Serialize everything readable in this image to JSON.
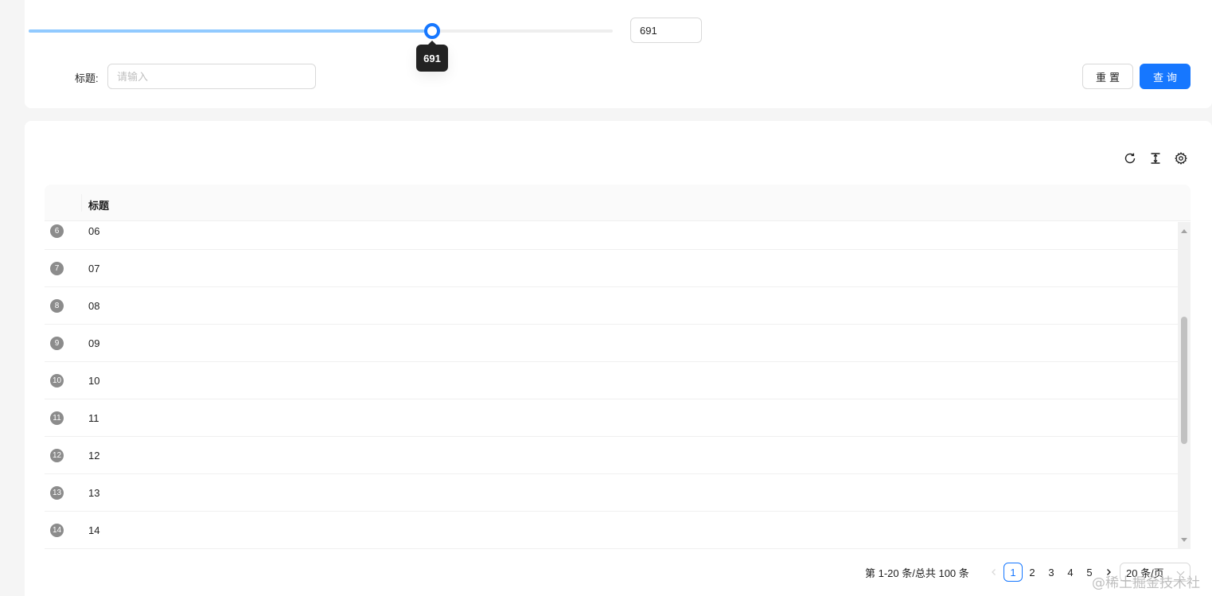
{
  "search": {
    "slider_value": 691,
    "slider_min": 0,
    "slider_max": 1000,
    "slider_value_text": "691",
    "tooltip_text": "691",
    "number_input_value": "691",
    "title_label": "标题:",
    "title_placeholder": "请输入",
    "reset_label": "重置",
    "search_label": "查询"
  },
  "toolbar": {
    "icons": [
      "reload-icon",
      "column-height-icon",
      "setting-icon"
    ]
  },
  "table": {
    "columns": [
      "标题"
    ],
    "rows": [
      {
        "index": "6",
        "title": "06"
      },
      {
        "index": "7",
        "title": "07"
      },
      {
        "index": "8",
        "title": "08"
      },
      {
        "index": "9",
        "title": "09"
      },
      {
        "index": "10",
        "title": "10"
      },
      {
        "index": "11",
        "title": "11"
      },
      {
        "index": "12",
        "title": "12"
      },
      {
        "index": "13",
        "title": "13"
      },
      {
        "index": "14",
        "title": "14"
      }
    ]
  },
  "pagination": {
    "total_text": "第 1-20 条/总共 100 条",
    "pages": [
      "1",
      "2",
      "3",
      "4",
      "5"
    ],
    "current": "1",
    "page_size": "20 条/页"
  },
  "watermark": "@稀土掘金技术社区",
  "colors": {
    "primary": "#1677ff",
    "track": "#91caff",
    "index_badge": "#8c8c8c"
  }
}
